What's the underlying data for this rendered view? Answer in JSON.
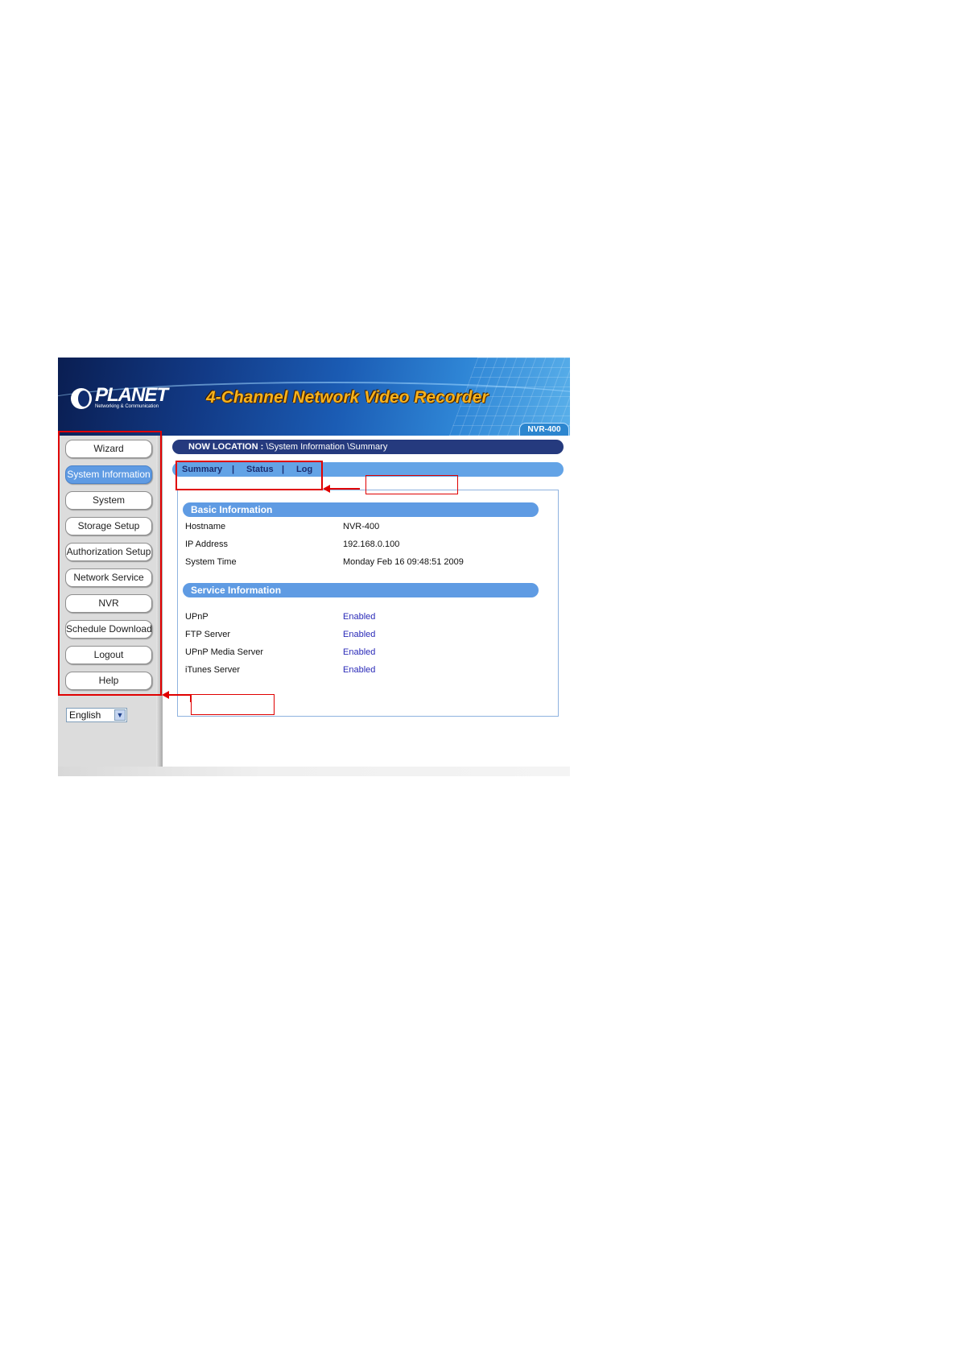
{
  "banner": {
    "logo_name": "PLANET",
    "logo_tagline": "Networking & Communication",
    "title": "4-Channel Network Video Recorder",
    "model": "NVR-400"
  },
  "sidebar": {
    "items": [
      {
        "label": "Wizard",
        "active": false
      },
      {
        "label": "System Information",
        "active": true
      },
      {
        "label": "System",
        "active": false
      },
      {
        "label": "Storage Setup",
        "active": false
      },
      {
        "label": "Authorization Setup",
        "active": false
      },
      {
        "label": "Network Service",
        "active": false
      },
      {
        "label": "NVR",
        "active": false
      },
      {
        "label": "Schedule Download",
        "active": false
      },
      {
        "label": "Logout",
        "active": false
      },
      {
        "label": "Help",
        "active": false
      }
    ],
    "language": "English"
  },
  "location": {
    "prefix": "NOW LOCATION :",
    "path": " \\System Information \\Summary"
  },
  "tabs": [
    {
      "label": "Summary",
      "active": true
    },
    {
      "label": "Status",
      "active": false
    },
    {
      "label": "Log",
      "active": false
    }
  ],
  "tab_separator": "|",
  "basic_info": {
    "heading": "Basic Information",
    "rows": [
      {
        "label": "Hostname",
        "value": "NVR-400"
      },
      {
        "label": "IP Address",
        "value": "192.168.0.100"
      },
      {
        "label": "System Time",
        "value": "Monday Feb 16 09:48:51 2009"
      }
    ]
  },
  "service_info": {
    "heading": "Service Information",
    "rows": [
      {
        "label": "UPnP",
        "value": "Enabled"
      },
      {
        "label": "FTP Server",
        "value": "Enabled"
      },
      {
        "label": "UPnP Media Server",
        "value": "Enabled"
      },
      {
        "label": "iTunes Server",
        "value": "Enabled"
      }
    ]
  },
  "colors": {
    "accent_blue": "#5f9be3",
    "location_bar": "#253a7e",
    "annotation_red": "#e00000",
    "banner_title": "#f6b21c"
  },
  "icons": {
    "language_dropdown": "chevron-down-icon",
    "logo": "planet-logo-icon"
  }
}
